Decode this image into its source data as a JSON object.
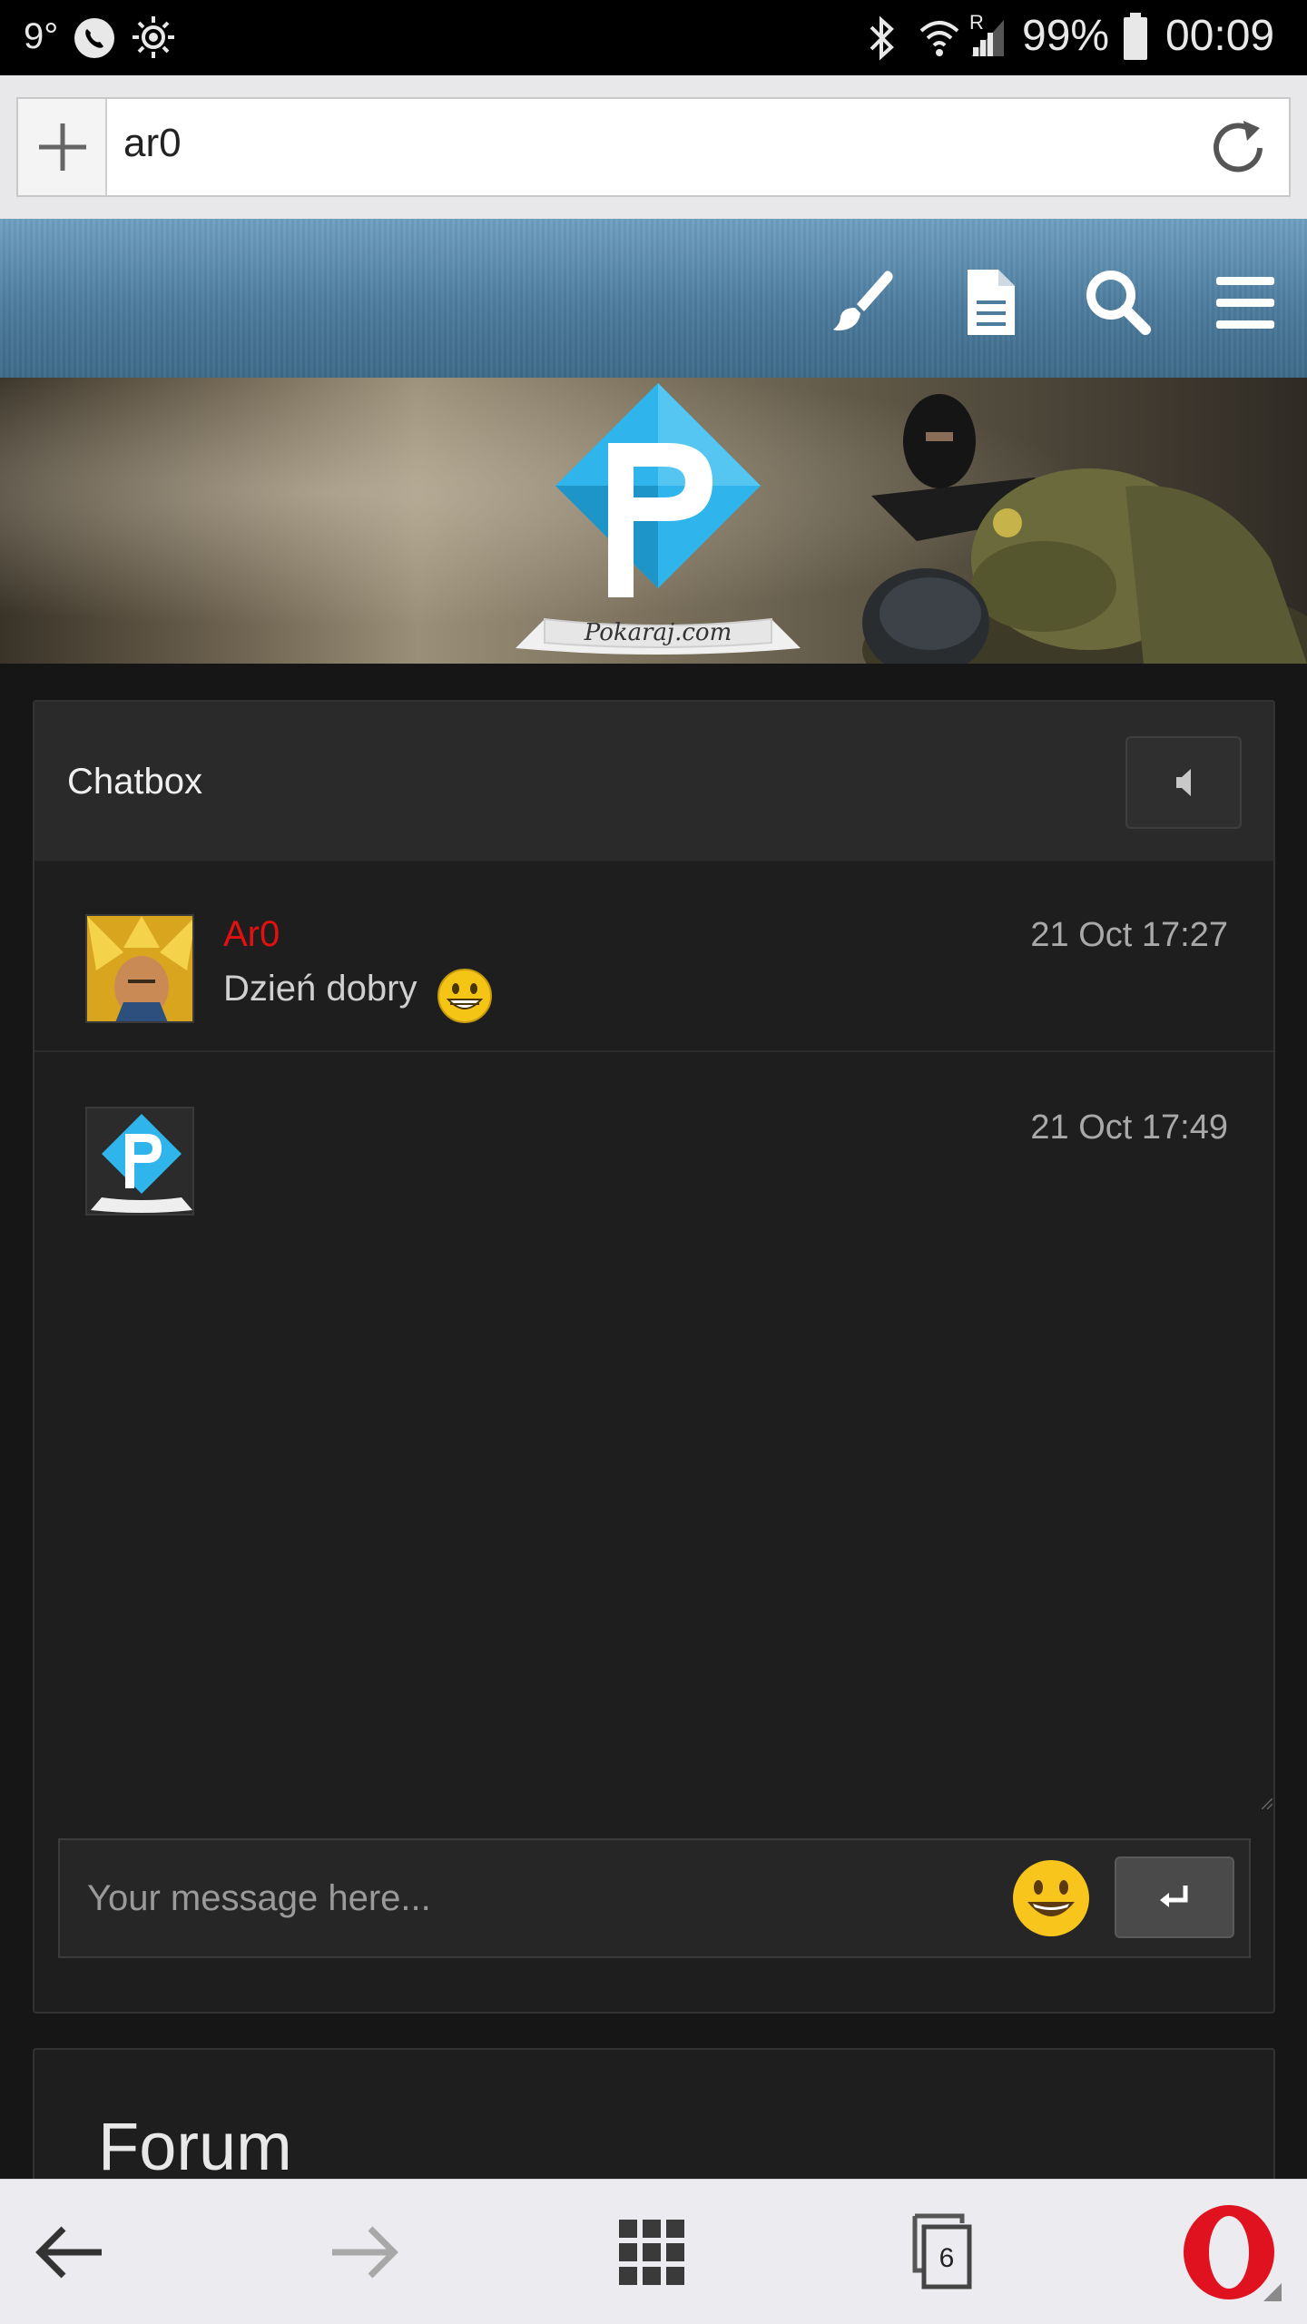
{
  "status_bar": {
    "temperature": "9°",
    "battery_percent": "99%",
    "clock": "00:09",
    "signal_label": "R"
  },
  "browser": {
    "address_text": "ar0",
    "tab_count": "6"
  },
  "banner": {
    "logo_letter": "P",
    "logo_caption": "Pokaraj.com"
  },
  "chatbox": {
    "title": "Chatbox",
    "messages": [
      {
        "author": "Ar0",
        "text": "Dzień dobry",
        "timestamp": "21 Oct 17:27"
      },
      {
        "author": "",
        "text": "",
        "timestamp": "21 Oct 17:49"
      }
    ],
    "input_placeholder": "Your message here..."
  },
  "forum": {
    "title": "Forum"
  },
  "colors": {
    "author_name": "#e31010",
    "nav_blue": "#4d7c9d",
    "logo_blue": "#2fb4ec",
    "panel_bg": "#1e1e1e",
    "opera_red": "#e0121f"
  }
}
